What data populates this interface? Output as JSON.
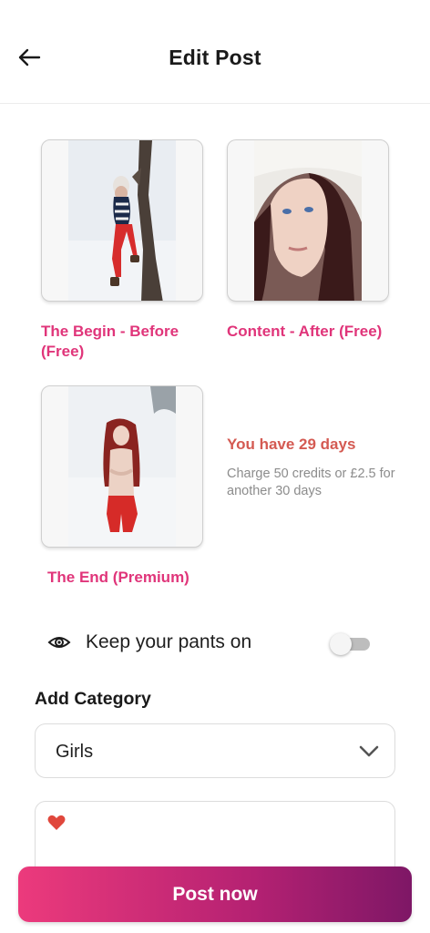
{
  "header": {
    "title": "Edit Post"
  },
  "posts": [
    {
      "label": "The Begin - Before (Free)"
    },
    {
      "label": "Content - After (Free)"
    },
    {
      "label": "The End (Premium)"
    }
  ],
  "info": {
    "title": "You have 29 days",
    "subtitle": "Charge 50 credits or £2.5 for another 30 days"
  },
  "toggle": {
    "label": "Keep your pants on",
    "on": false
  },
  "category": {
    "label": "Add Category",
    "selected": "Girls"
  },
  "colors": {
    "accent": "#e0357a",
    "info_title": "#d45a52",
    "button_start": "#ec3a7c",
    "button_end": "#7e1766"
  },
  "submit": {
    "label": "Post now"
  }
}
